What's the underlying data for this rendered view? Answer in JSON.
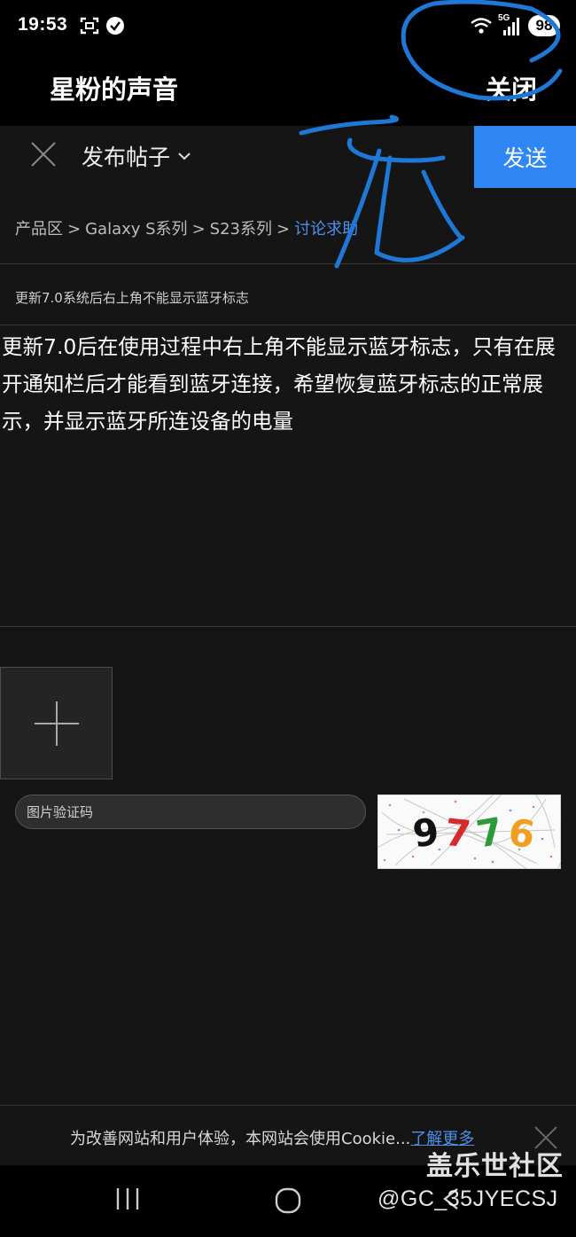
{
  "status_bar": {
    "time": "19:53",
    "network_label": "5G",
    "battery": "98",
    "icons": [
      "screenshot-icon",
      "check-badge-icon",
      "wifi-icon",
      "signal-icon"
    ]
  },
  "header": {
    "title": "星粉的声音",
    "close_label": "关闭"
  },
  "compose": {
    "post_type_label": "发布帖子",
    "send_label": "发送"
  },
  "breadcrumb": {
    "items": [
      "产品区",
      "Galaxy S系列",
      "S23系列"
    ],
    "current": "讨论求助",
    "separator": ">"
  },
  "post": {
    "title": "更新7.0系统后右上角不能显示蓝牙标志",
    "body": "更新7.0后在使用过程中右上角不能显示蓝牙标志，只有在展开通知栏后才能看到蓝牙连接，希望恢复蓝牙标志的正常展示，并显示蓝牙所连设备的电量"
  },
  "captcha": {
    "placeholder": "图片验证码",
    "code": "9776",
    "digit_colors": [
      "#111111",
      "#d62b2b",
      "#2a9a3a",
      "#f0a020"
    ]
  },
  "cookie_banner": {
    "text": "为改善网站和用户体验，本网站会使用Cookie...",
    "link_label": "了解更多"
  },
  "watermark": {
    "site": "盖乐世社区",
    "user": "@GC_35JYECSJ"
  },
  "annotation_text": "无",
  "colors": {
    "accent": "#2f86f5",
    "link": "#4d8fea",
    "background": "#151515",
    "annotation_ink": "#1e78d6"
  }
}
